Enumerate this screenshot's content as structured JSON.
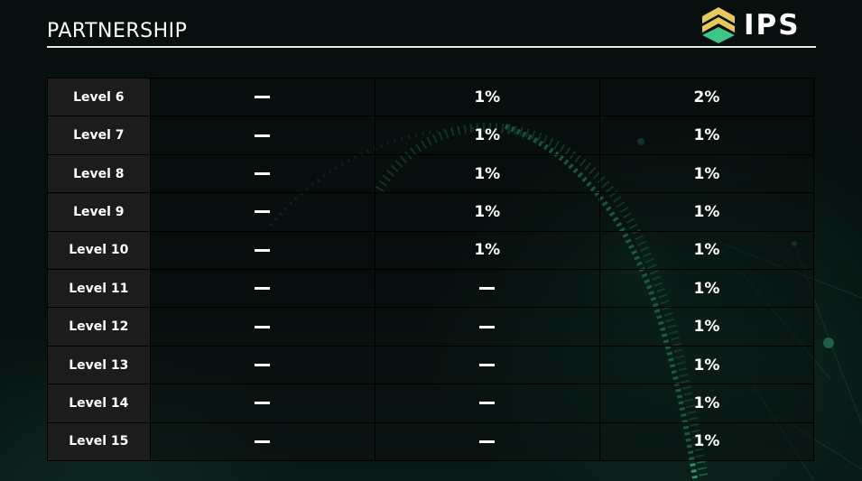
{
  "header": {
    "title": "PARTNERSHIP"
  },
  "logo": {
    "text": "IPS",
    "icon": "chevron-stack-icon",
    "colors": {
      "gold": "#e8c85a",
      "green": "#3ec58a"
    }
  },
  "table": {
    "rows": [
      {
        "level": "Level 6",
        "col1": "—",
        "col2": "1%",
        "col3": "2%"
      },
      {
        "level": "Level 7",
        "col1": "—",
        "col2": "1%",
        "col3": "1%"
      },
      {
        "level": "Level 8",
        "col1": "—",
        "col2": "1%",
        "col3": "1%"
      },
      {
        "level": "Level 9",
        "col1": "—",
        "col2": "1%",
        "col3": "1%"
      },
      {
        "level": "Level 10",
        "col1": "—",
        "col2": "1%",
        "col3": "1%"
      },
      {
        "level": "Level 11",
        "col1": "—",
        "col2": "—",
        "col3": "1%"
      },
      {
        "level": "Level 12",
        "col1": "—",
        "col2": "—",
        "col3": "1%"
      },
      {
        "level": "Level 13",
        "col1": "—",
        "col2": "—",
        "col3": "1%"
      },
      {
        "level": "Level 14",
        "col1": "—",
        "col2": "—",
        "col3": "1%"
      },
      {
        "level": "Level 15",
        "col1": "—",
        "col2": "—",
        "col3": "1%"
      }
    ]
  },
  "theme": {
    "accent": "#2fb884",
    "background": "#06100e"
  }
}
